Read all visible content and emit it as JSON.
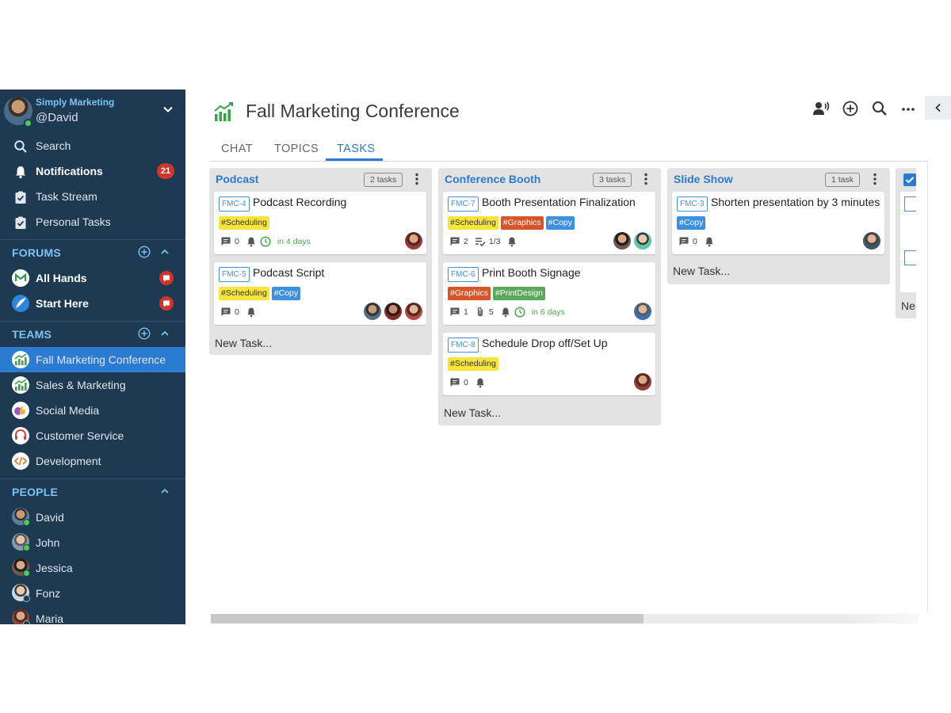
{
  "account": {
    "org": "Simply Marketing",
    "user": "@David"
  },
  "nav": {
    "search": "Search",
    "notifications": "Notifications",
    "notifications_count": "21",
    "task_stream": "Task Stream",
    "personal_tasks": "Personal Tasks"
  },
  "forums": {
    "header": "FORUMS",
    "items": [
      {
        "label": "All Hands"
      },
      {
        "label": "Start Here"
      }
    ]
  },
  "teams": {
    "header": "TEAMS",
    "items": [
      {
        "label": "Fall Marketing Conference",
        "active": true
      },
      {
        "label": "Sales & Marketing"
      },
      {
        "label": "Social Media"
      },
      {
        "label": "Customer Service"
      },
      {
        "label": "Development"
      }
    ]
  },
  "people": {
    "header": "PEOPLE",
    "items": [
      {
        "label": "David",
        "status": "online"
      },
      {
        "label": "John",
        "status": "online"
      },
      {
        "label": "Jessica",
        "status": "online"
      },
      {
        "label": "Fonz",
        "status": "away"
      },
      {
        "label": "Maria",
        "status": "away"
      }
    ]
  },
  "header": {
    "title": "Fall Marketing Conference"
  },
  "tabs": [
    {
      "label": "CHAT"
    },
    {
      "label": "TOPICS"
    },
    {
      "label": "TASKS",
      "active": true
    }
  ],
  "board": {
    "new_task_label": "New Task...",
    "lists": [
      {
        "name": "Podcast",
        "count": "2 tasks",
        "cards": [
          {
            "key": "FMC-4",
            "title": "Podcast Recording",
            "tags": [
              "#Scheduling"
            ],
            "comments": "0",
            "due": "in 4 days"
          },
          {
            "key": "FMC-5",
            "title": "Podcast Script",
            "tags": [
              "#Scheduling",
              "#Copy"
            ],
            "comments": "0"
          }
        ]
      },
      {
        "name": "Conference Booth",
        "count": "3 tasks",
        "cards": [
          {
            "key": "FMC-7",
            "title": "Booth Presentation Finalization",
            "tags": [
              "#Scheduling",
              "#Graphics",
              "#Copy"
            ],
            "comments": "2",
            "checklist": "1/3"
          },
          {
            "key": "FMC-6",
            "title": "Print Booth Signage",
            "tags": [
              "#Graphics",
              "#PrintDesign"
            ],
            "comments": "1",
            "attachments": "5",
            "due": "in 6 days"
          },
          {
            "key": "FMC-8",
            "title": "Schedule Drop off/Set Up",
            "tags": [
              "#Scheduling"
            ],
            "comments": "0"
          }
        ]
      },
      {
        "name": "Slide Show",
        "count": "1 task",
        "cards": [
          {
            "key": "FMC-3",
            "title": "Shorten presentation by 3 minutes",
            "tags": [
              "#Copy"
            ],
            "comments": "0"
          }
        ]
      },
      {
        "partial_label": "Ne"
      }
    ]
  },
  "colors": {
    "sidebar": "#1e3a52",
    "accent": "#2c7bd2",
    "badge": "#d0342c",
    "section": "#7cc3f2"
  }
}
